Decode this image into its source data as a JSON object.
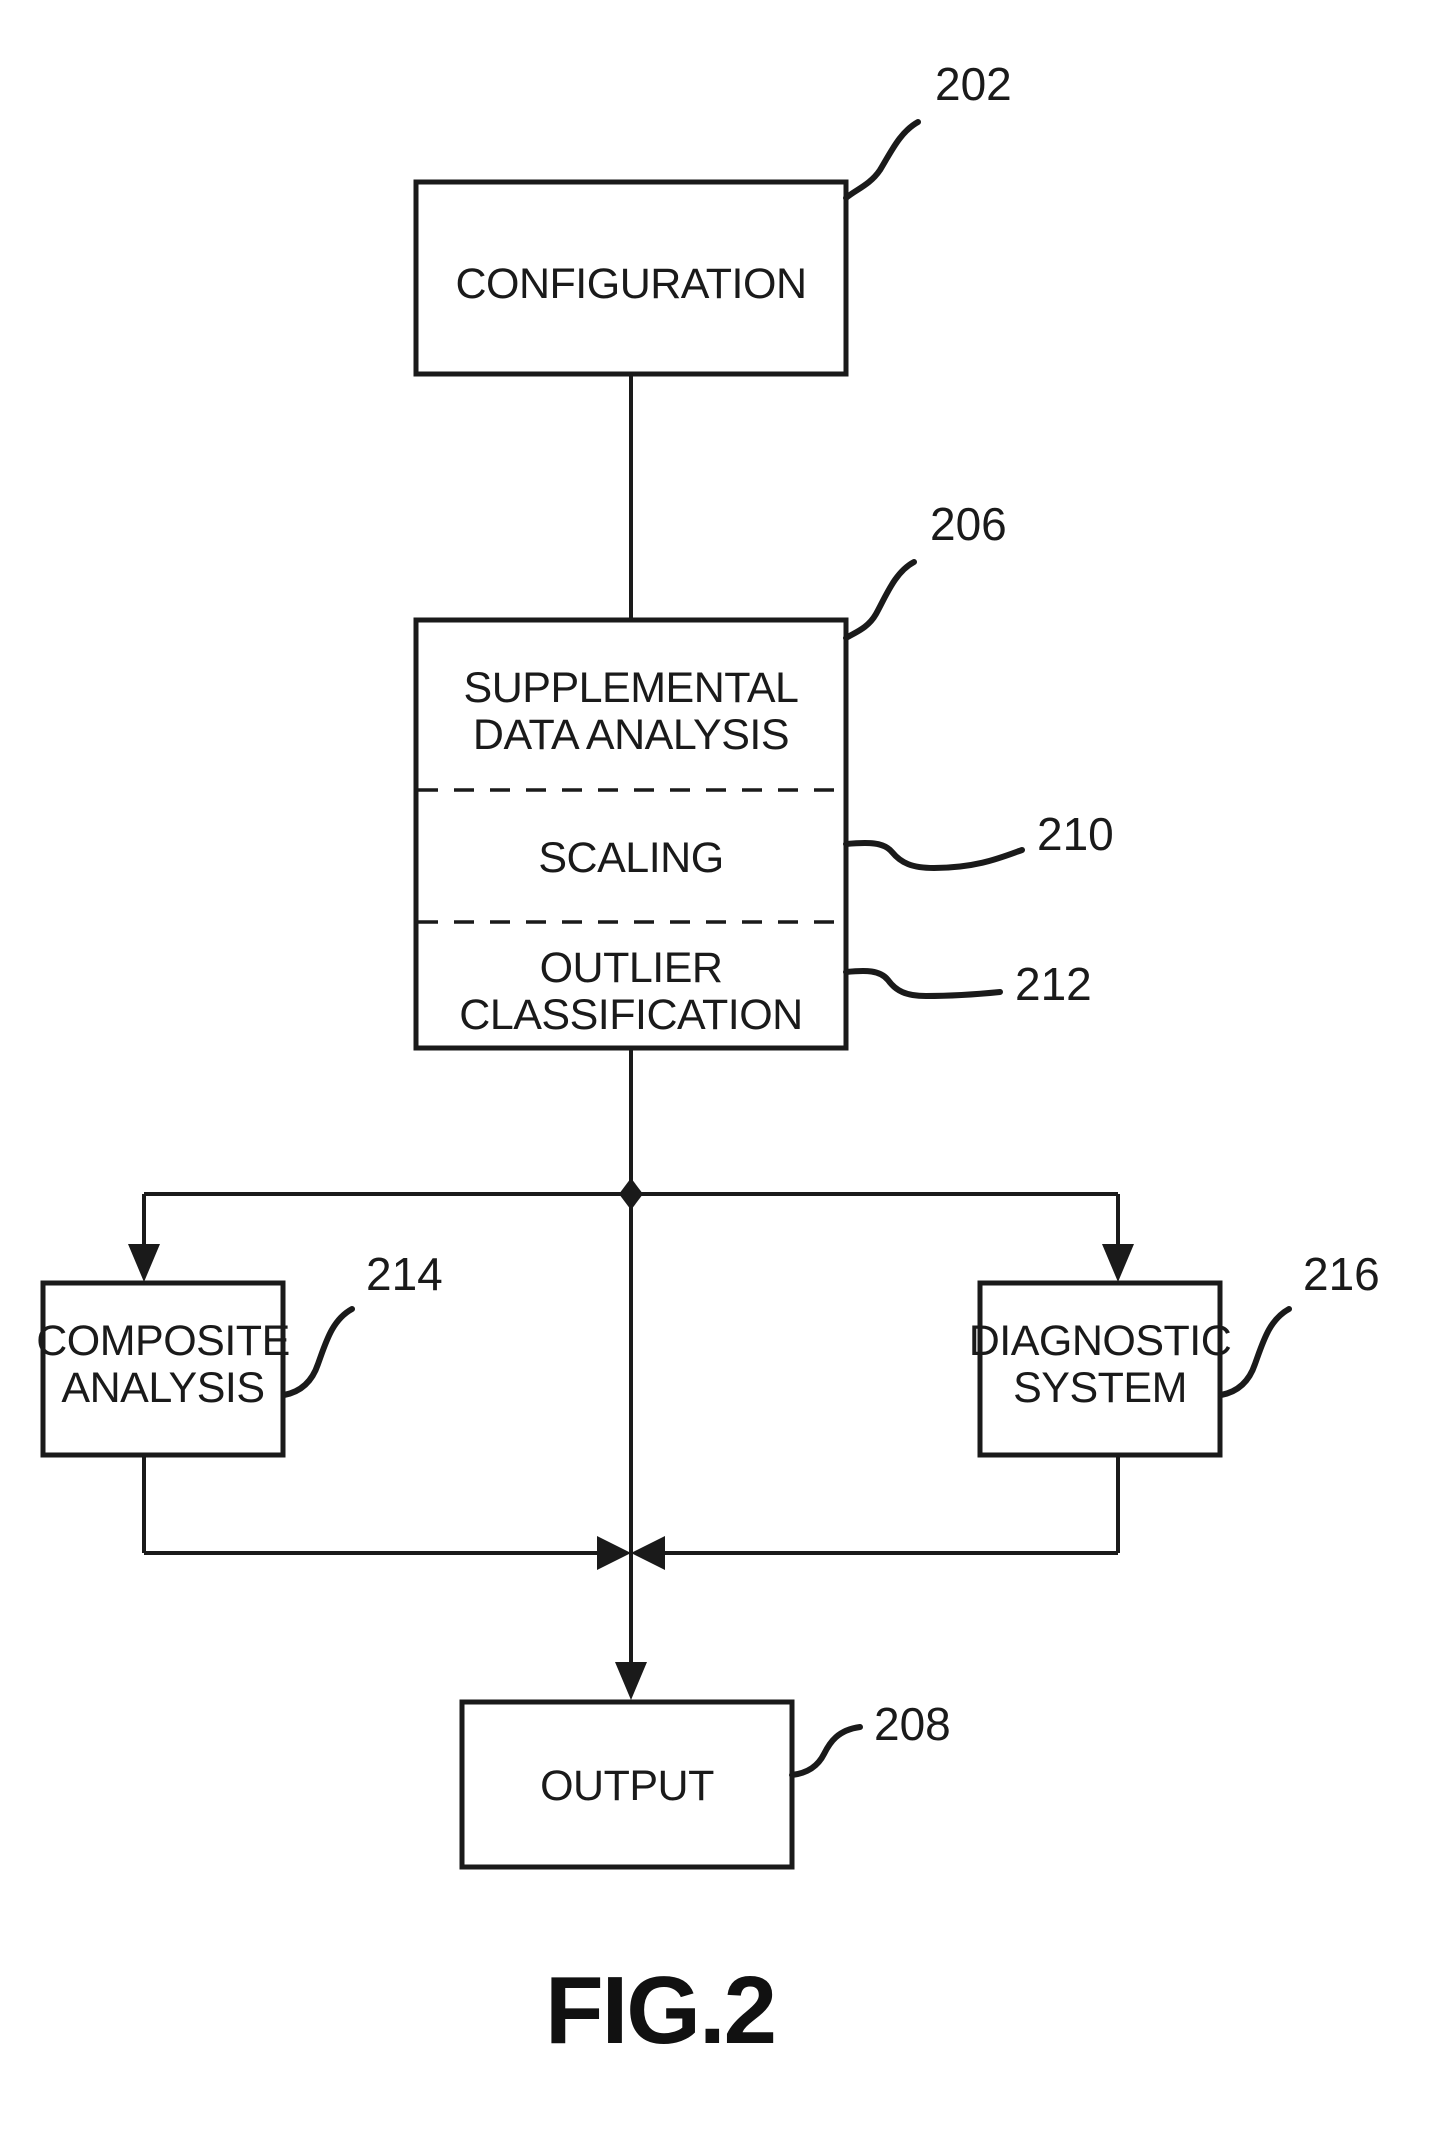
{
  "figure": {
    "caption": "FIG.2",
    "title": "FIG.2"
  },
  "boxes": {
    "configuration": {
      "label": "CONFIGURATION",
      "ref": "202"
    },
    "supplemental": {
      "ref": "206",
      "sections": [
        {
          "lines": [
            "SUPPLEMENTAL",
            "DATA ANALYSIS"
          ],
          "ref": "206"
        },
        {
          "lines": [
            "SCALING"
          ],
          "ref": "210"
        },
        {
          "lines": [
            "OUTLIER",
            "CLASSIFICATION"
          ],
          "ref": "212"
        }
      ]
    },
    "composite": {
      "lines": [
        "COMPOSITE",
        "ANALYSIS"
      ],
      "ref": "214"
    },
    "diagnostic": {
      "lines": [
        "DIAGNOSTIC",
        "SYSTEM"
      ],
      "ref": "216"
    },
    "output": {
      "label": "OUTPUT",
      "ref": "208"
    }
  },
  "refs": {
    "r202": "202",
    "r206": "206",
    "r208": "208",
    "r210": "210",
    "r212": "212",
    "r214": "214",
    "r216": "216"
  },
  "text": {
    "configuration": "CONFIGURATION",
    "supplemental_line1": "SUPPLEMENTAL",
    "supplemental_line2": "DATA ANALYSIS",
    "scaling": "SCALING",
    "outlier_line1": "OUTLIER",
    "outlier_line2": "CLASSIFICATION",
    "composite_line1": "COMPOSITE",
    "composite_line2": "ANALYSIS",
    "diagnostic_line1": "DIAGNOSTIC",
    "diagnostic_line2": "SYSTEM",
    "output": "OUTPUT",
    "fig_caption": "FIG.2"
  },
  "colors": {
    "ink": "#1a1a1a",
    "paper": "#ffffff"
  }
}
